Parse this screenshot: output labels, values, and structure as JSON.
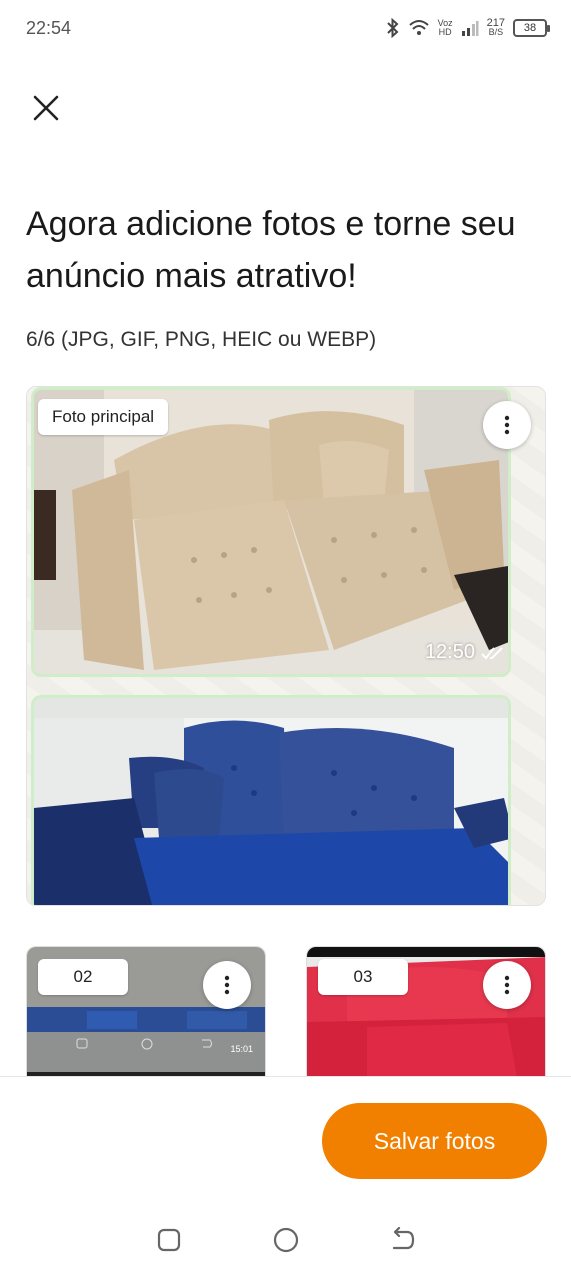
{
  "status_bar": {
    "time": "22:54",
    "network_top": "Voz",
    "network_bottom": "HD",
    "speed_top": "217",
    "speed_bottom": "B/S",
    "battery": "38"
  },
  "header": {
    "title": "Agora adicione fotos e torne seu anúncio mais atrativo!",
    "subtitle": "6/6 (JPG, GIF, PNG, HEIC ou WEBP)"
  },
  "photos": [
    {
      "badge": "Foto principal",
      "timestamp": "12:50"
    },
    {
      "badge": "02",
      "timestamp": "15:01"
    },
    {
      "badge": "03"
    }
  ],
  "footer": {
    "save_label": "Salvar fotos"
  },
  "colors": {
    "accent": "#f28000"
  }
}
